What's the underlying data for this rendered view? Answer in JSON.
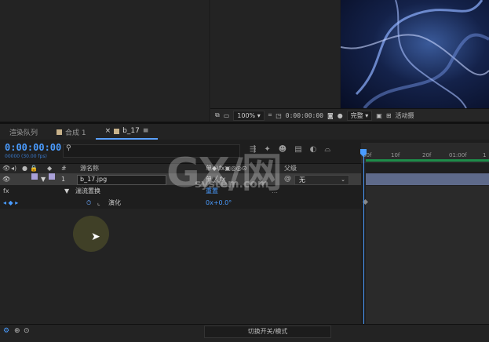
{
  "viewer": {
    "zoom": "100%",
    "timecode": "0:00:00:00",
    "quality": "完整",
    "active_camera": "活动摄"
  },
  "tabs": [
    {
      "label": "渲染队列"
    },
    {
      "label": "合成 1"
    },
    {
      "label": "b_17"
    }
  ],
  "timeline": {
    "current_time": "0:00:00:00",
    "time_sub": "00000 (30.00 fps)",
    "search_placeholder": "",
    "ruler_ticks": [
      "00f",
      "10f",
      "20f",
      "01:00f",
      "1"
    ],
    "columns": {
      "number": "#",
      "source_name": "源名称",
      "switches": "单◆\\fx▣◎◎⊙",
      "parent": "父级"
    },
    "layer": {
      "index": "1",
      "name": "b_17.jpg",
      "parent": "无"
    },
    "effect": {
      "fx_label": "fx",
      "name": "湍流置换",
      "reset": "重置"
    },
    "property": {
      "name": "演化",
      "value": "0x+0.0°"
    },
    "bottom_toggle": "切换开关/模式"
  },
  "watermark": {
    "main": "GX/网",
    "sub": "system.com"
  }
}
